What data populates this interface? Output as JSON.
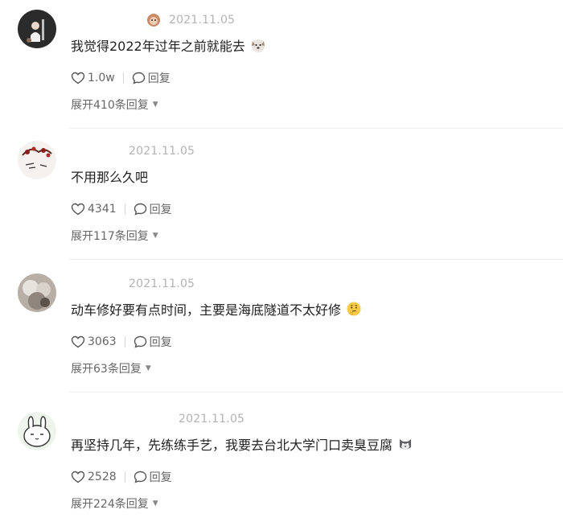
{
  "comments": [
    {
      "date": "2021.11.05",
      "text": "我觉得2022年过年之前就能去",
      "emoji": "dog-face-icon",
      "likes": "1.0w",
      "reply_label": "回复",
      "expand_label": "展开410条回复"
    },
    {
      "date": "2021.11.05",
      "text": "不用那么久吧",
      "likes": "4341",
      "reply_label": "回复",
      "expand_label": "展开117条回复"
    },
    {
      "date": "2021.11.05",
      "text": "动车修好要有点时间，主要是海底隧道不太好修",
      "emoji": "thinking-face-icon",
      "likes": "3063",
      "reply_label": "回复",
      "expand_label": "展开63条回复"
    },
    {
      "date": "2021.11.05",
      "text": "再坚持几年，先练练手艺，我要去台北大学门口卖臭豆腐",
      "emoji": "cat-face-icon",
      "likes": "2528",
      "reply_label": "回复",
      "expand_label": "展开224条回复"
    }
  ],
  "colors": {
    "text": "#1f1f1f",
    "meta": "#b3b3b3",
    "action": "#666666"
  }
}
